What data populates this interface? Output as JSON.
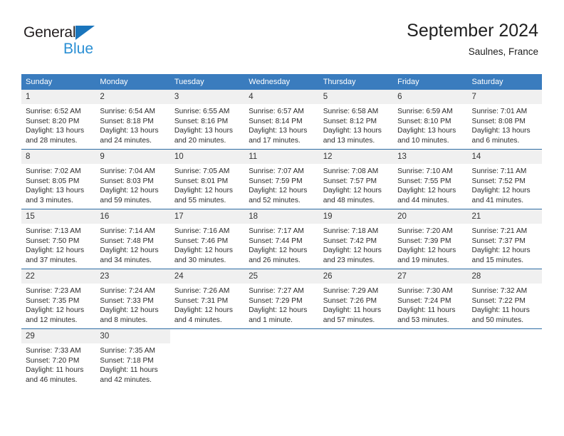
{
  "brand": {
    "name_part1": "General",
    "name_part2": "Blue",
    "triangle_icon": "triangle-icon",
    "accent_color": "#2a8fd4",
    "logo_dark_color": "#231f20"
  },
  "header": {
    "title": "September 2024",
    "subtitle": "Saulnes, France",
    "header_bg_color": "#3a7cbe",
    "row_divider_color": "#2e6da4",
    "daynum_bg_color": "#f0f0f0"
  },
  "weekday_headers": [
    "Sunday",
    "Monday",
    "Tuesday",
    "Wednesday",
    "Thursday",
    "Friday",
    "Saturday"
  ],
  "weeks": [
    [
      {
        "day": "1",
        "sunrise": "Sunrise: 6:52 AM",
        "sunset": "Sunset: 8:20 PM",
        "daylight_line1": "Daylight: 13 hours",
        "daylight_line2": "and 28 minutes."
      },
      {
        "day": "2",
        "sunrise": "Sunrise: 6:54 AM",
        "sunset": "Sunset: 8:18 PM",
        "daylight_line1": "Daylight: 13 hours",
        "daylight_line2": "and 24 minutes."
      },
      {
        "day": "3",
        "sunrise": "Sunrise: 6:55 AM",
        "sunset": "Sunset: 8:16 PM",
        "daylight_line1": "Daylight: 13 hours",
        "daylight_line2": "and 20 minutes."
      },
      {
        "day": "4",
        "sunrise": "Sunrise: 6:57 AM",
        "sunset": "Sunset: 8:14 PM",
        "daylight_line1": "Daylight: 13 hours",
        "daylight_line2": "and 17 minutes."
      },
      {
        "day": "5",
        "sunrise": "Sunrise: 6:58 AM",
        "sunset": "Sunset: 8:12 PM",
        "daylight_line1": "Daylight: 13 hours",
        "daylight_line2": "and 13 minutes."
      },
      {
        "day": "6",
        "sunrise": "Sunrise: 6:59 AM",
        "sunset": "Sunset: 8:10 PM",
        "daylight_line1": "Daylight: 13 hours",
        "daylight_line2": "and 10 minutes."
      },
      {
        "day": "7",
        "sunrise": "Sunrise: 7:01 AM",
        "sunset": "Sunset: 8:08 PM",
        "daylight_line1": "Daylight: 13 hours",
        "daylight_line2": "and 6 minutes."
      }
    ],
    [
      {
        "day": "8",
        "sunrise": "Sunrise: 7:02 AM",
        "sunset": "Sunset: 8:05 PM",
        "daylight_line1": "Daylight: 13 hours",
        "daylight_line2": "and 3 minutes."
      },
      {
        "day": "9",
        "sunrise": "Sunrise: 7:04 AM",
        "sunset": "Sunset: 8:03 PM",
        "daylight_line1": "Daylight: 12 hours",
        "daylight_line2": "and 59 minutes."
      },
      {
        "day": "10",
        "sunrise": "Sunrise: 7:05 AM",
        "sunset": "Sunset: 8:01 PM",
        "daylight_line1": "Daylight: 12 hours",
        "daylight_line2": "and 55 minutes."
      },
      {
        "day": "11",
        "sunrise": "Sunrise: 7:07 AM",
        "sunset": "Sunset: 7:59 PM",
        "daylight_line1": "Daylight: 12 hours",
        "daylight_line2": "and 52 minutes."
      },
      {
        "day": "12",
        "sunrise": "Sunrise: 7:08 AM",
        "sunset": "Sunset: 7:57 PM",
        "daylight_line1": "Daylight: 12 hours",
        "daylight_line2": "and 48 minutes."
      },
      {
        "day": "13",
        "sunrise": "Sunrise: 7:10 AM",
        "sunset": "Sunset: 7:55 PM",
        "daylight_line1": "Daylight: 12 hours",
        "daylight_line2": "and 44 minutes."
      },
      {
        "day": "14",
        "sunrise": "Sunrise: 7:11 AM",
        "sunset": "Sunset: 7:52 PM",
        "daylight_line1": "Daylight: 12 hours",
        "daylight_line2": "and 41 minutes."
      }
    ],
    [
      {
        "day": "15",
        "sunrise": "Sunrise: 7:13 AM",
        "sunset": "Sunset: 7:50 PM",
        "daylight_line1": "Daylight: 12 hours",
        "daylight_line2": "and 37 minutes."
      },
      {
        "day": "16",
        "sunrise": "Sunrise: 7:14 AM",
        "sunset": "Sunset: 7:48 PM",
        "daylight_line1": "Daylight: 12 hours",
        "daylight_line2": "and 34 minutes."
      },
      {
        "day": "17",
        "sunrise": "Sunrise: 7:16 AM",
        "sunset": "Sunset: 7:46 PM",
        "daylight_line1": "Daylight: 12 hours",
        "daylight_line2": "and 30 minutes."
      },
      {
        "day": "18",
        "sunrise": "Sunrise: 7:17 AM",
        "sunset": "Sunset: 7:44 PM",
        "daylight_line1": "Daylight: 12 hours",
        "daylight_line2": "and 26 minutes."
      },
      {
        "day": "19",
        "sunrise": "Sunrise: 7:18 AM",
        "sunset": "Sunset: 7:42 PM",
        "daylight_line1": "Daylight: 12 hours",
        "daylight_line2": "and 23 minutes."
      },
      {
        "day": "20",
        "sunrise": "Sunrise: 7:20 AM",
        "sunset": "Sunset: 7:39 PM",
        "daylight_line1": "Daylight: 12 hours",
        "daylight_line2": "and 19 minutes."
      },
      {
        "day": "21",
        "sunrise": "Sunrise: 7:21 AM",
        "sunset": "Sunset: 7:37 PM",
        "daylight_line1": "Daylight: 12 hours",
        "daylight_line2": "and 15 minutes."
      }
    ],
    [
      {
        "day": "22",
        "sunrise": "Sunrise: 7:23 AM",
        "sunset": "Sunset: 7:35 PM",
        "daylight_line1": "Daylight: 12 hours",
        "daylight_line2": "and 12 minutes."
      },
      {
        "day": "23",
        "sunrise": "Sunrise: 7:24 AM",
        "sunset": "Sunset: 7:33 PM",
        "daylight_line1": "Daylight: 12 hours",
        "daylight_line2": "and 8 minutes."
      },
      {
        "day": "24",
        "sunrise": "Sunrise: 7:26 AM",
        "sunset": "Sunset: 7:31 PM",
        "daylight_line1": "Daylight: 12 hours",
        "daylight_line2": "and 4 minutes."
      },
      {
        "day": "25",
        "sunrise": "Sunrise: 7:27 AM",
        "sunset": "Sunset: 7:29 PM",
        "daylight_line1": "Daylight: 12 hours",
        "daylight_line2": "and 1 minute."
      },
      {
        "day": "26",
        "sunrise": "Sunrise: 7:29 AM",
        "sunset": "Sunset: 7:26 PM",
        "daylight_line1": "Daylight: 11 hours",
        "daylight_line2": "and 57 minutes."
      },
      {
        "day": "27",
        "sunrise": "Sunrise: 7:30 AM",
        "sunset": "Sunset: 7:24 PM",
        "daylight_line1": "Daylight: 11 hours",
        "daylight_line2": "and 53 minutes."
      },
      {
        "day": "28",
        "sunrise": "Sunrise: 7:32 AM",
        "sunset": "Sunset: 7:22 PM",
        "daylight_line1": "Daylight: 11 hours",
        "daylight_line2": "and 50 minutes."
      }
    ],
    [
      {
        "day": "29",
        "sunrise": "Sunrise: 7:33 AM",
        "sunset": "Sunset: 7:20 PM",
        "daylight_line1": "Daylight: 11 hours",
        "daylight_line2": "and 46 minutes."
      },
      {
        "day": "30",
        "sunrise": "Sunrise: 7:35 AM",
        "sunset": "Sunset: 7:18 PM",
        "daylight_line1": "Daylight: 11 hours",
        "daylight_line2": "and 42 minutes."
      },
      {
        "day": "",
        "sunrise": "",
        "sunset": "",
        "daylight_line1": "",
        "daylight_line2": ""
      },
      {
        "day": "",
        "sunrise": "",
        "sunset": "",
        "daylight_line1": "",
        "daylight_line2": ""
      },
      {
        "day": "",
        "sunrise": "",
        "sunset": "",
        "daylight_line1": "",
        "daylight_line2": ""
      },
      {
        "day": "",
        "sunrise": "",
        "sunset": "",
        "daylight_line1": "",
        "daylight_line2": ""
      },
      {
        "day": "",
        "sunrise": "",
        "sunset": "",
        "daylight_line1": "",
        "daylight_line2": ""
      }
    ]
  ]
}
